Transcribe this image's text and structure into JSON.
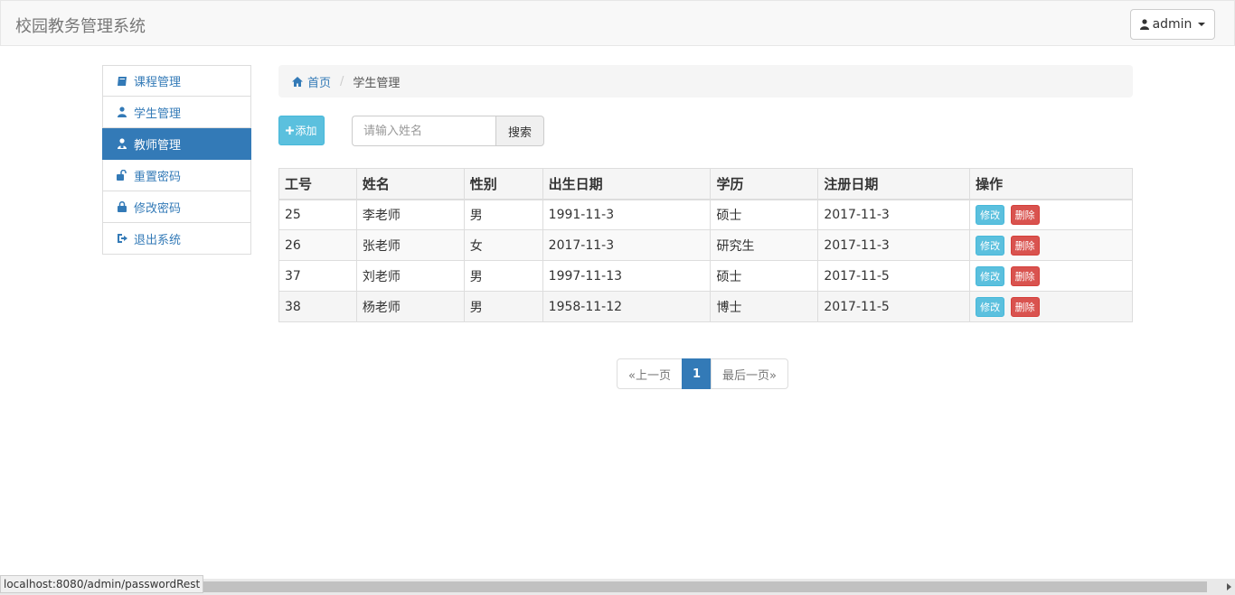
{
  "navbar": {
    "brand": "校园教务管理系统",
    "user_label": "admin"
  },
  "sidebar": {
    "items": [
      {
        "label": "课程管理",
        "icon": "book-icon"
      },
      {
        "label": "学生管理",
        "icon": "user-icon"
      },
      {
        "label": "教师管理",
        "icon": "teacher-icon",
        "active": true
      },
      {
        "label": "重置密码",
        "icon": "unlock-icon"
      },
      {
        "label": "修改密码",
        "icon": "lock-icon"
      },
      {
        "label": "退出系统",
        "icon": "logout-icon"
      }
    ]
  },
  "breadcrumb": {
    "home": "首页",
    "current": "学生管理"
  },
  "toolbar": {
    "add_label": "添加",
    "search_placeholder": "请输入姓名",
    "search_label": "搜索"
  },
  "table": {
    "headers": [
      "工号",
      "姓名",
      "性别",
      "出生日期",
      "学历",
      "注册日期",
      "操作"
    ],
    "rows": [
      [
        "25",
        "李老师",
        "男",
        "1991-11-3",
        "硕士",
        "2017-11-3"
      ],
      [
        "26",
        "张老师",
        "女",
        "2017-11-3",
        "研究生",
        "2017-11-3"
      ],
      [
        "37",
        "刘老师",
        "男",
        "1997-11-13",
        "硕士",
        "2017-11-5"
      ],
      [
        "38",
        "杨老师",
        "男",
        "1958-11-12",
        "博士",
        "2017-11-5"
      ]
    ],
    "edit_label": "修改",
    "delete_label": "删除"
  },
  "pagination": {
    "prev": "«上一页",
    "current": "1",
    "last": "最后一页»"
  },
  "statusbar": {
    "url": "localhost:8080/admin/passwordRest"
  },
  "colors": {
    "primary": "#337ab7",
    "info": "#5bc0de",
    "danger": "#d9534f"
  }
}
